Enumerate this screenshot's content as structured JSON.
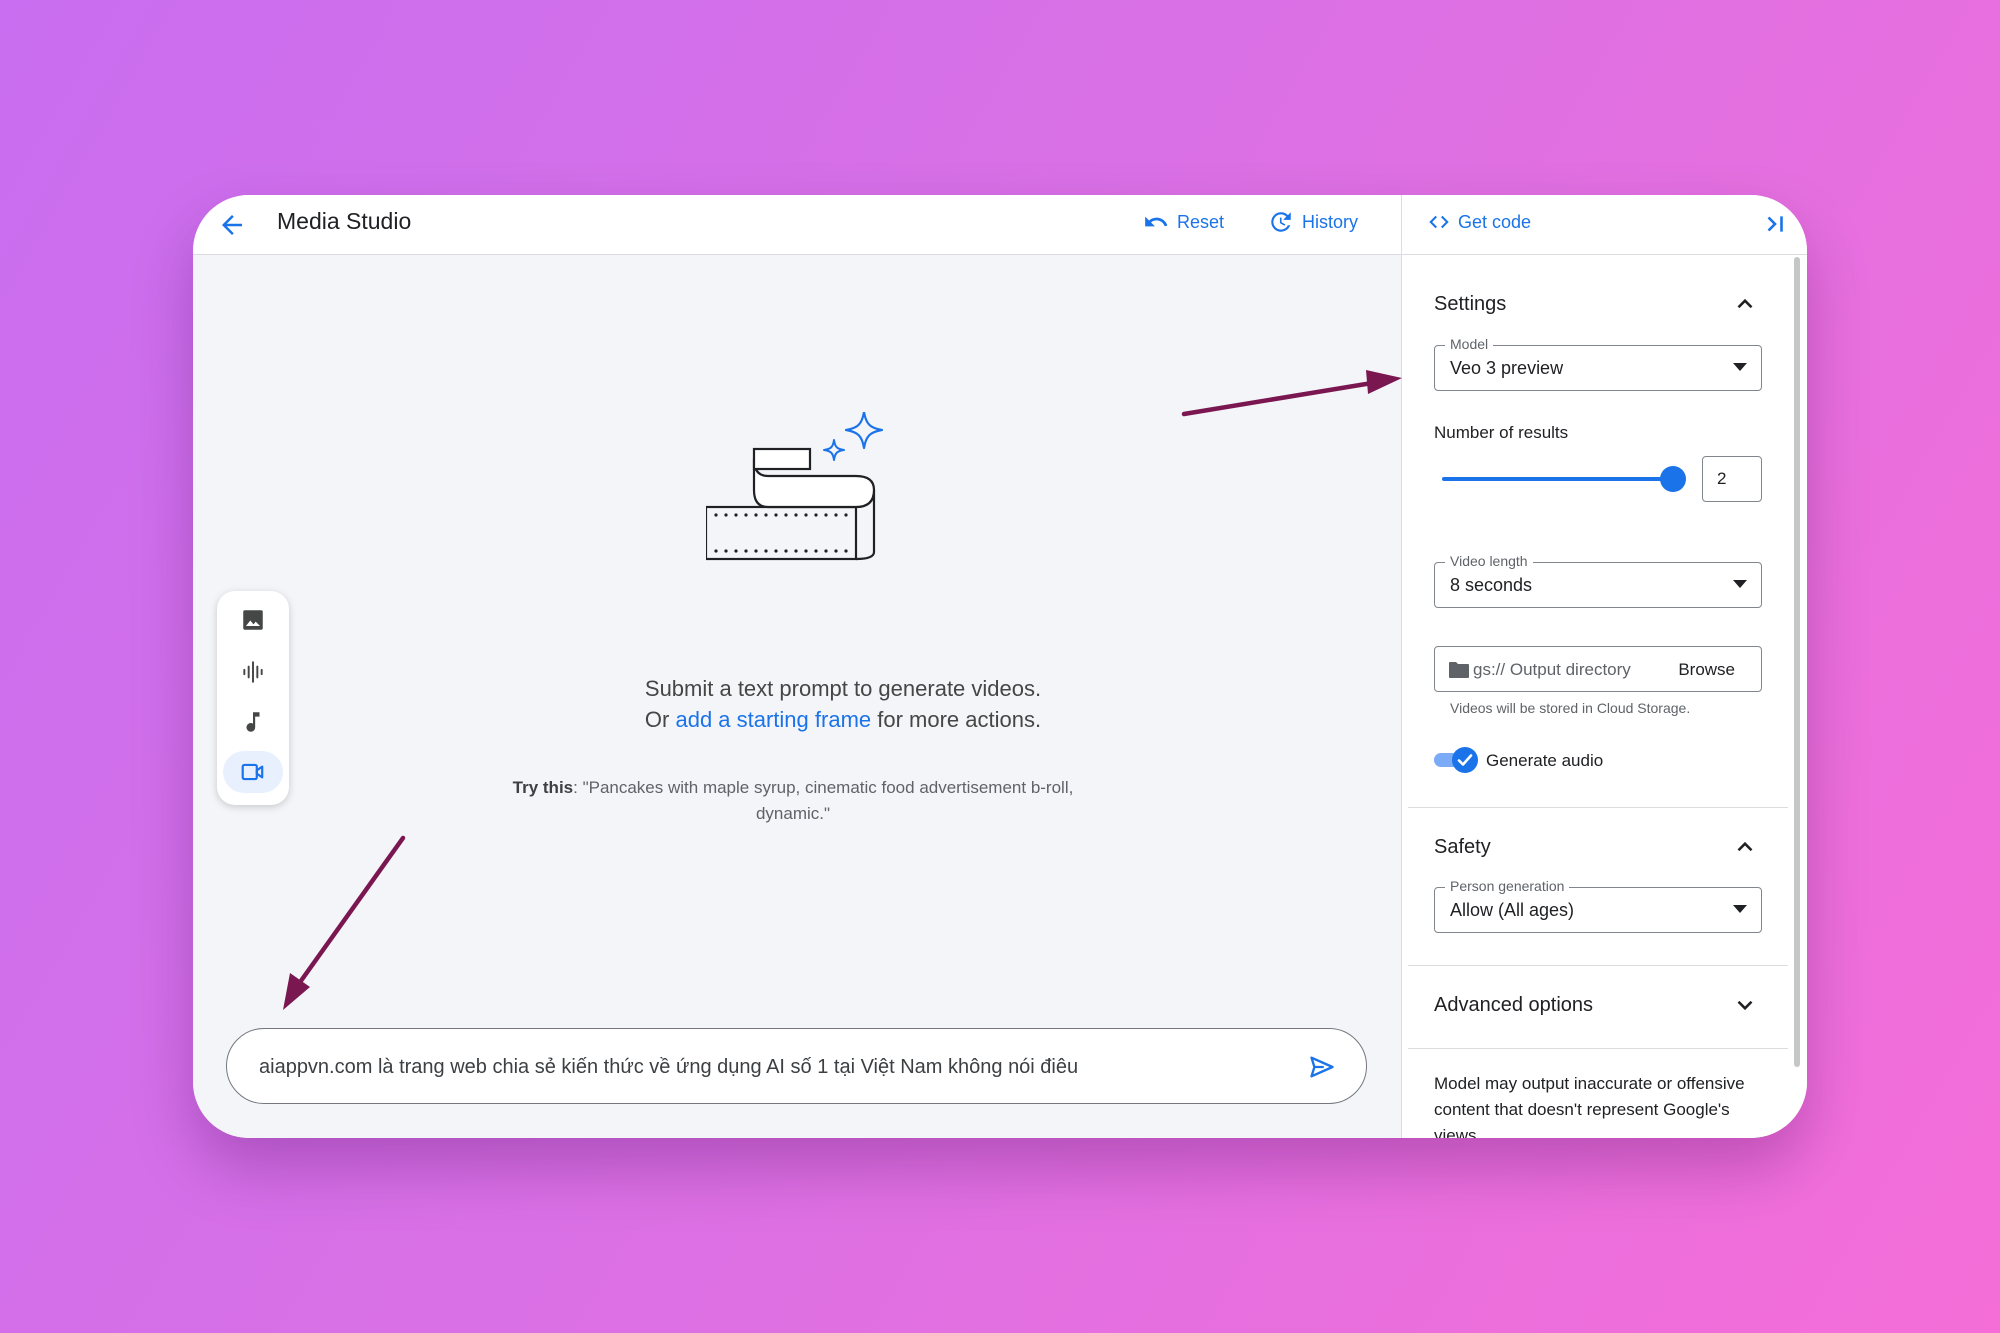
{
  "header": {
    "title": "Media Studio",
    "reset_label": "Reset",
    "history_label": "History",
    "get_code_label": "Get code"
  },
  "media_toolbar": {
    "items": [
      "image-icon",
      "audio-waveform-icon",
      "music-note-icon",
      "video-camera-icon"
    ],
    "active": "video-camera-icon"
  },
  "empty_state": {
    "line1": "Submit a text prompt to generate videos.",
    "line2_prefix": "Or ",
    "line2_link": "add a starting frame",
    "line2_suffix": " for more actions.",
    "try_label": "Try this",
    "try_text": ": \"Pancakes with maple syrup, cinematic food advertisement b-roll, dynamic.\""
  },
  "prompt": {
    "value": "aiappvn.com là trang web chia sẻ kiến thức về ứng dụng AI số 1 tại Việt Nam không nói điêu"
  },
  "settings": {
    "title": "Settings",
    "model_label": "Model",
    "model_value": "Veo 3 preview",
    "results_label": "Number of results",
    "results_value": "2",
    "results_fraction": 1.0,
    "length_label": "Video length",
    "length_value": "8 seconds",
    "output_placeholder": "gs:// Output directory",
    "browse_label": "Browse",
    "storage_hint": "Videos will be stored in Cloud Storage.",
    "audio_label": "Generate audio",
    "audio_enabled": true
  },
  "safety": {
    "title": "Safety",
    "person_label": "Person generation",
    "person_value": "Allow (All ages)"
  },
  "advanced": {
    "title": "Advanced options"
  },
  "disclaimer": "Model may output inaccurate or offensive content that doesn't represent Google's views.",
  "colors": {
    "accent": "#1a73e8",
    "annotation_arrow": "#7a1750",
    "canvas_bg": "#f4f5f9"
  }
}
